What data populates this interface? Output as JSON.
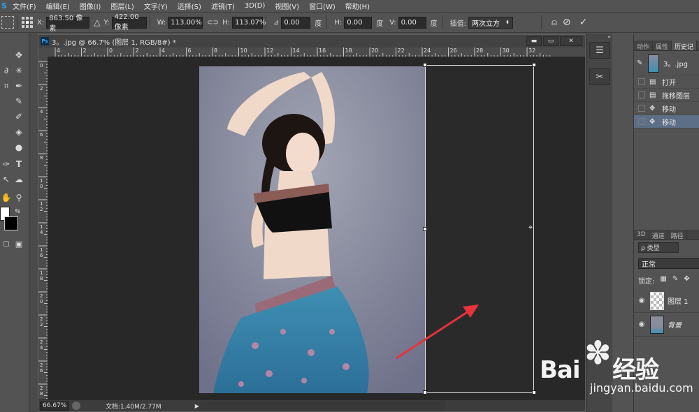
{
  "app": {
    "logo": "S"
  },
  "menu": [
    "文件(F)",
    "编辑(E)",
    "图像(I)",
    "图层(L)",
    "文字(Y)",
    "选择(S)",
    "滤镜(T)",
    "3D(D)",
    "视图(V)",
    "窗口(W)",
    "帮助(H)"
  ],
  "options": {
    "x_label": "X:",
    "x_value": "863.50 像素",
    "y_label": "Y:",
    "y_value": "422.00 像素",
    "w_label": "W:",
    "w_value": "113.00%",
    "h_label": "H:",
    "h_value": "113.07%",
    "angle_value": "0.00",
    "angle_unit": "度",
    "hskew_label": "H:",
    "hskew_value": "0.00",
    "hskew_unit": "度",
    "vskew_label": "V:",
    "vskew_value": "0.00",
    "vskew_unit": "度",
    "interp_label": "插值:",
    "interp_value": "两次立方"
  },
  "document": {
    "title": "3。.jpg @ 66.7% (图层 1, RGB/8#) *",
    "ruler_h": [
      "4",
      "2",
      "0",
      "2",
      "4",
      "6",
      "8",
      "10",
      "12",
      "14",
      "16",
      "18",
      "20",
      "22",
      "24",
      "26",
      "28",
      "30",
      "32"
    ],
    "ruler_v": [
      "0",
      "2",
      "4",
      "6",
      "8",
      "1 0",
      "1 2",
      "1 4",
      "1 6",
      "1 8",
      "2 0",
      "2 2",
      "2 4",
      "2 6",
      "2 8"
    ],
    "zoom": "66.67%",
    "doc_info": "文档:1.40M/2.77M"
  },
  "panels": {
    "top_tabs": [
      "动作",
      "属性",
      "历史记"
    ],
    "history": [
      {
        "label": "3。.jpg",
        "type": "snapshot"
      },
      {
        "label": "打开",
        "type": "doc"
      },
      {
        "label": "拖移图层",
        "type": "doc"
      },
      {
        "label": "移动",
        "type": "move"
      },
      {
        "label": "移动",
        "type": "move",
        "selected": true
      }
    ],
    "layer_tabs": [
      "3D",
      "通道",
      "路径"
    ],
    "filter_label": "ρ 类型",
    "blend_mode": "正常",
    "lock_label": "锁定:",
    "layers": [
      {
        "name": "图层 1",
        "thumb": "transparent"
      },
      {
        "name": "背景",
        "thumb": "photo"
      }
    ]
  },
  "watermark": {
    "brand": "Bai",
    "brand_cn": "经验",
    "url": "jingyan.baidu.com"
  },
  "colors": {
    "accent": "#2fa3f0",
    "history_selected": "#5d6f86",
    "arrow": "#e8323c"
  }
}
